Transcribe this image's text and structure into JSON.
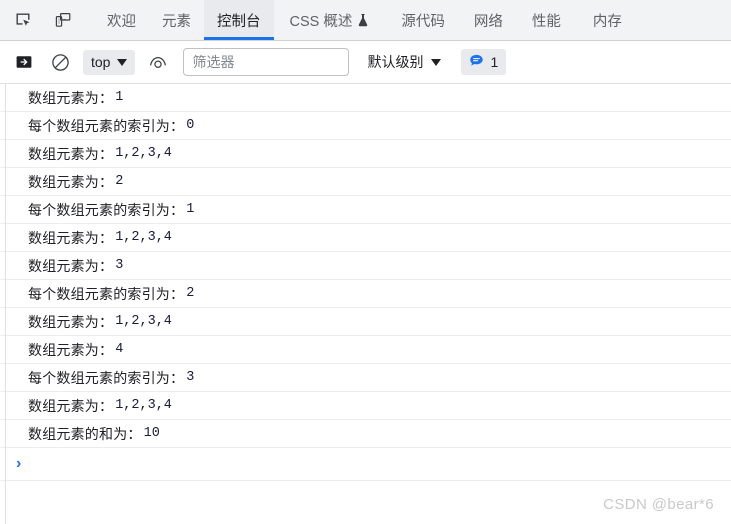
{
  "tabstrip": {
    "icons": [
      {
        "name": "inspect-element-icon",
        "title": "Inspect element"
      },
      {
        "name": "device-toolbar-icon",
        "title": "Toggle device toolbar"
      }
    ],
    "tabs": [
      {
        "id": "welcome",
        "label": "欢迎",
        "active": false,
        "experimental": false
      },
      {
        "id": "elements",
        "label": "元素",
        "active": false,
        "experimental": false
      },
      {
        "id": "console",
        "label": "控制台",
        "active": true,
        "experimental": false
      },
      {
        "id": "css-overview",
        "label": "CSS 概述",
        "active": false,
        "experimental": true
      },
      {
        "id": "sources",
        "label": "源代码",
        "active": false,
        "experimental": false
      },
      {
        "id": "network",
        "label": "网络",
        "active": false,
        "experimental": false
      },
      {
        "id": "performance",
        "label": "性能",
        "active": false,
        "experimental": false
      },
      {
        "id": "memory",
        "label": "内存",
        "active": false,
        "experimental": false
      }
    ]
  },
  "toolbar": {
    "sidebar_toggle_name": "console-sidebar-icon",
    "clear_console_name": "clear-console-icon",
    "context": "top",
    "eye_icon_name": "live-expression-icon",
    "filter_placeholder": "筛选器",
    "filter_value": "",
    "level": "默认级别",
    "message_count": "1"
  },
  "console": {
    "messages": [
      {
        "label": "数组元素为：",
        "value": "1"
      },
      {
        "label": "每个数组元素的索引为：",
        "value": "0"
      },
      {
        "label": "数组元素为：",
        "value": "1,2,3,4"
      },
      {
        "label": "数组元素为：",
        "value": "2"
      },
      {
        "label": "每个数组元素的索引为：",
        "value": "1"
      },
      {
        "label": "数组元素为：",
        "value": "1,2,3,4"
      },
      {
        "label": "数组元素为：",
        "value": "3"
      },
      {
        "label": "每个数组元素的索引为：",
        "value": "2"
      },
      {
        "label": "数组元素为：",
        "value": "1,2,3,4"
      },
      {
        "label": "数组元素为：",
        "value": "4"
      },
      {
        "label": "每个数组元素的索引为：",
        "value": "3"
      },
      {
        "label": "数组元素为：",
        "value": "1,2,3,4"
      },
      {
        "label": "数组元素的和为：",
        "value": "10"
      }
    ],
    "prompt_symbol": "›"
  },
  "watermark": "CSDN @bear*6",
  "colors": {
    "accent": "#1a73e8",
    "tabstrip_bg": "#f1f3f4",
    "active_tab_bg": "#e8eaed",
    "text": "#202124",
    "muted_text": "#5f6368",
    "value_text": "#1a1a3c",
    "row_divider": "#ededed",
    "watermark": "#c9c9c9"
  }
}
